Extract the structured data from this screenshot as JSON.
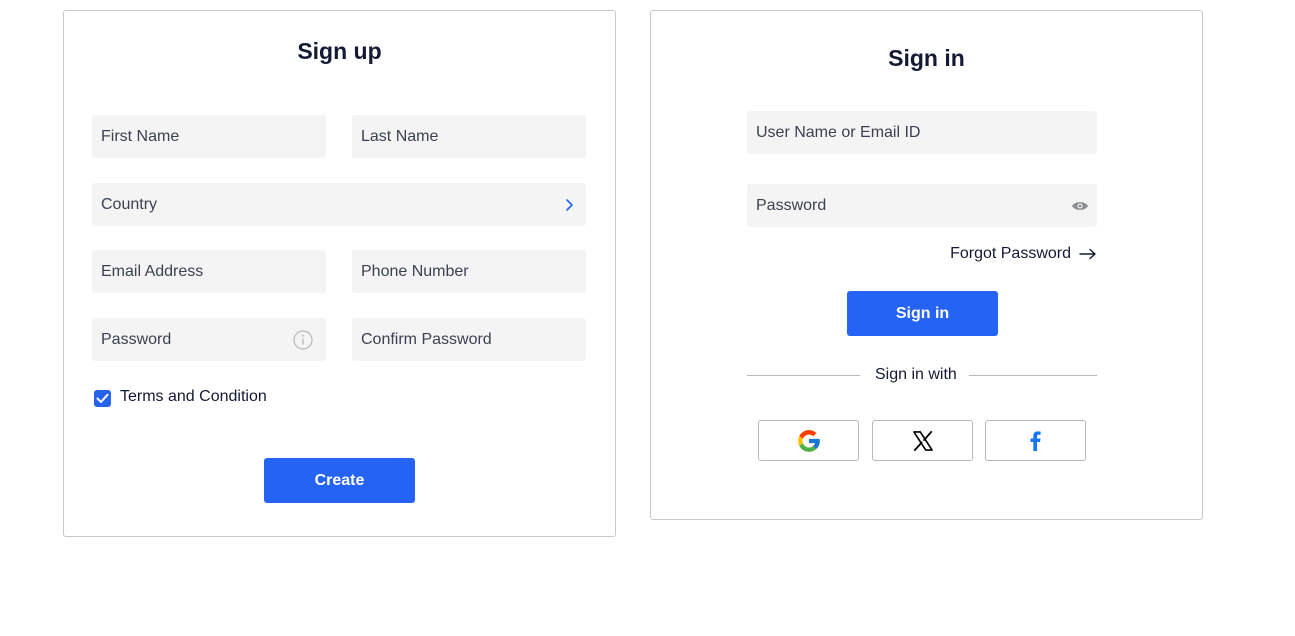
{
  "signup": {
    "title": "Sign up",
    "first_name_placeholder": "First Name",
    "last_name_placeholder": "Last Name",
    "country_placeholder": "Country",
    "email_placeholder": "Email Address",
    "phone_placeholder": "Phone Number",
    "password_placeholder": "Password",
    "confirm_password_placeholder": "Confirm Password",
    "terms_label": "Terms and Condition",
    "terms_checked": true,
    "create_label": "Create",
    "icons": {
      "country": "chevron-right-icon",
      "password": "info-icon",
      "terms": "checkmark-icon"
    }
  },
  "signin": {
    "title": "Sign in",
    "username_placeholder": "User Name or Email ID",
    "password_placeholder": "Password",
    "forgot_label": "Forgot Password",
    "signin_label": "Sign in",
    "divider_label": "Sign in with",
    "icons": {
      "password": "eye-icon",
      "forgot": "arrow-right-icon"
    },
    "social": [
      "google-icon",
      "x-icon",
      "facebook-icon"
    ]
  },
  "colors": {
    "primary": "#2563f5",
    "field_bg": "#f4f4f5",
    "border": "#c9c9cc",
    "text": "#141a33"
  }
}
